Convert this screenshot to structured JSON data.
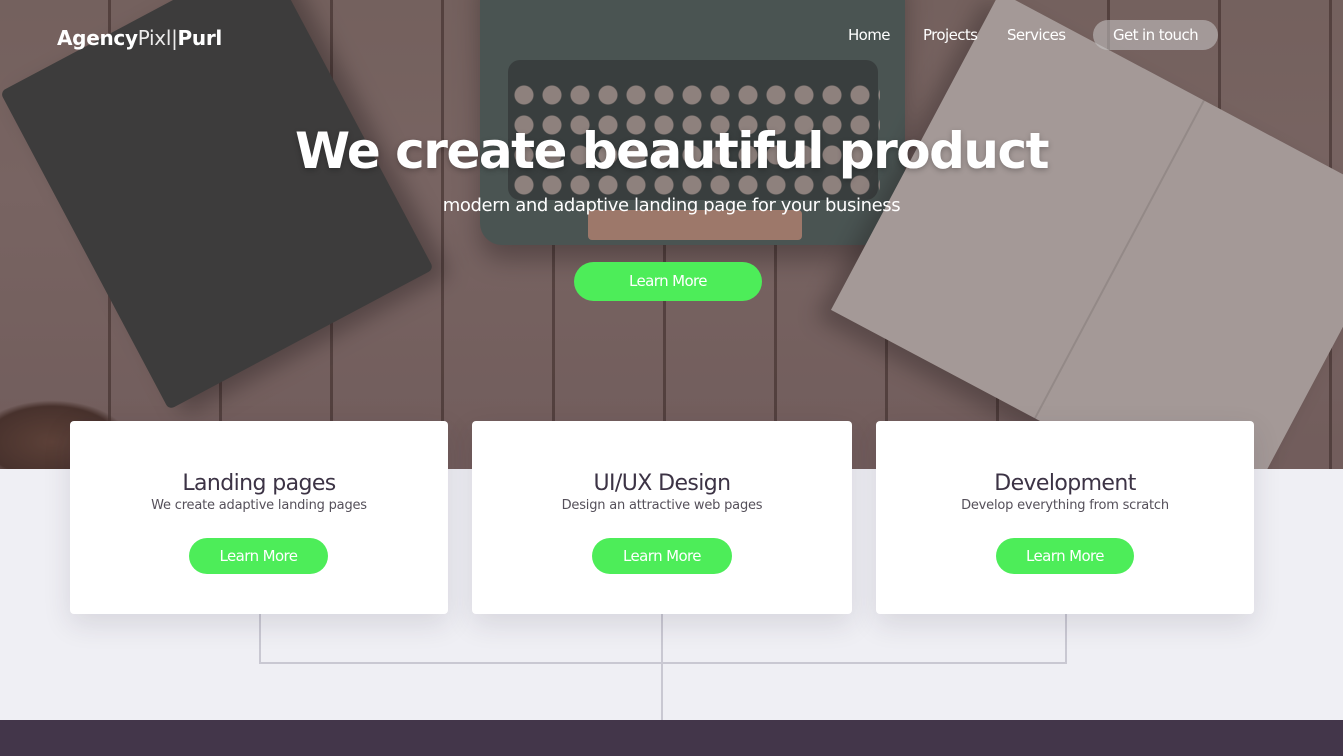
{
  "brand": {
    "part1": "Agency",
    "part2": "Pixl",
    "part3": "Purl"
  },
  "nav": {
    "home": "Home",
    "projects": "Projects",
    "services": "Services",
    "cta": "Get in touch"
  },
  "hero": {
    "title": "We create beautiful product",
    "subtitle": "modern and adaptive landing page for your business",
    "button": "Learn More"
  },
  "cards": [
    {
      "title": "Landing pages",
      "desc": "We create adaptive landing pages",
      "button": "Learn More"
    },
    {
      "title": "UI/UX Design",
      "desc": "Design an attractive web pages",
      "button": "Learn More"
    },
    {
      "title": "Development",
      "desc": "Develop everything from scratch",
      "button": "Learn More"
    }
  ],
  "colors": {
    "accent": "#4ded59",
    "footer": "#43364a",
    "background": "#efeff4",
    "text_dark": "#3c3345"
  }
}
